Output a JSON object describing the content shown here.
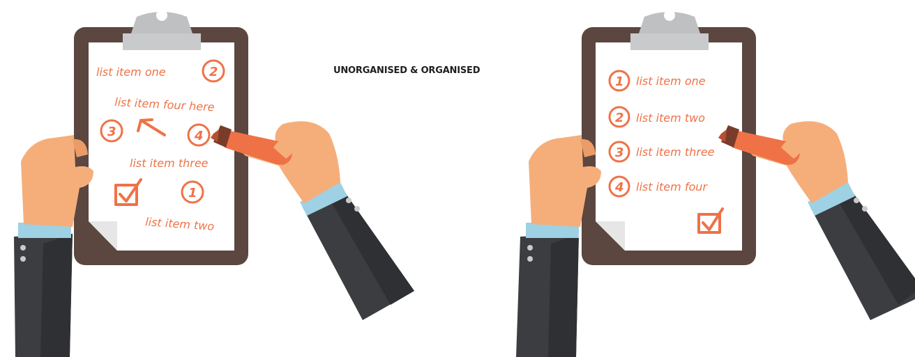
{
  "title": "UNORGANISED & ORGANISED",
  "colors": {
    "board": "#5b4640",
    "paper": "#ffffff",
    "clip": "#c9cacb",
    "ink": "#ef7247",
    "skin": "#f5ae7a",
    "sleeve": "#3b3d40",
    "cuff": "#9ed1e3"
  },
  "unorganised": {
    "items": [
      "list item one",
      "list item four here",
      "list item three",
      "list item two"
    ],
    "numbers": [
      "2",
      "3",
      "4",
      "1"
    ]
  },
  "organised": {
    "items": [
      {
        "num": "1",
        "label": "list item one"
      },
      {
        "num": "2",
        "label": "list item two"
      },
      {
        "num": "3",
        "label": "list item three"
      },
      {
        "num": "4",
        "label": "list item four"
      }
    ]
  }
}
